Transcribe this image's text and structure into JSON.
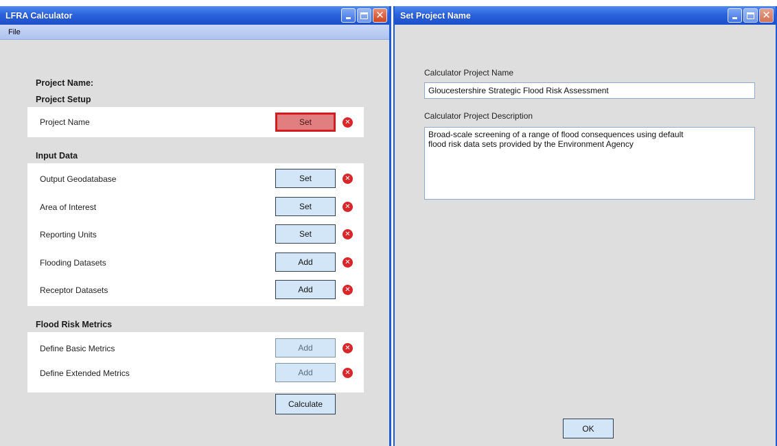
{
  "left_window": {
    "title": "LFRA Calculator",
    "menu": [
      "File"
    ],
    "project_name_label": "Project Name:",
    "sections": {
      "project_setup": {
        "heading": "Project Setup",
        "rows": [
          {
            "label": "Project Name",
            "button": "Set",
            "state": "active"
          }
        ]
      },
      "input_data": {
        "heading": "Input Data",
        "rows": [
          {
            "label": "Output Geodatabase",
            "button": "Set"
          },
          {
            "label": "Area of Interest",
            "button": "Set"
          },
          {
            "label": "Reporting Units",
            "button": "Set"
          },
          {
            "label": "Flooding Datasets",
            "button": "Add"
          },
          {
            "label": "Receptor Datasets",
            "button": "Add"
          }
        ]
      },
      "flood_risk_metrics": {
        "heading": "Flood Risk Metrics",
        "rows": [
          {
            "label": "Define Basic Metrics",
            "button": "Add",
            "state": "disabled"
          },
          {
            "label": "Define Extended Metrics",
            "button": "Add",
            "state": "disabled"
          }
        ]
      }
    },
    "calculate_button": "Calculate",
    "status_icon": "error-x-icon"
  },
  "right_window": {
    "title": "Set Project Name",
    "name_label": "Calculator Project Name",
    "name_value": "Gloucestershire Strategic Flood Risk Assessment",
    "description_label": "Calculator Project Description",
    "description_value": "Broad-scale screening of a range of flood consequences using default\nflood risk data sets provided by the Environment Agency",
    "ok_button": "OK"
  },
  "colors": {
    "title_bar": "#2b63dc",
    "active_button_fill": "#e07e80",
    "active_button_border": "#d21c22",
    "button_fill": "#d3e6f7",
    "error_icon": "#d8262a"
  }
}
